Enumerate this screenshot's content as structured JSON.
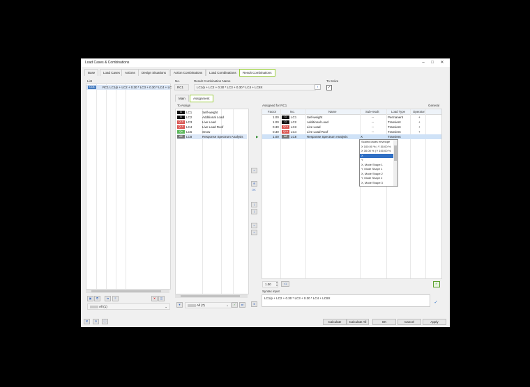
{
  "window": {
    "title": "Load Cases & Combinations"
  },
  "tabs": [
    "Base",
    "Load Cases",
    "Actions",
    "Design Situations",
    "Action Combinations",
    "Load Combinations",
    "Result Combinations"
  ],
  "list": {
    "label": "List",
    "item": {
      "badge": "CO1",
      "text": "RC1  LC1/p + LC2 + 0.30 * LC3 + 0.30 * LC4 + LC"
    },
    "filter": "All (1)"
  },
  "header": {
    "no_label": "No.",
    "no_value": "RC1",
    "name_label": "Result Combination Name",
    "name_value": "LC1/p + LC2 + 0.30 * LC3 + 0.30 * LC4 + LC8X",
    "fx": "f",
    "solve_label": "To Solve",
    "solve_check": "✓"
  },
  "subtabs": [
    "Main",
    "Assignment"
  ],
  "to_assign": {
    "label": "To Assign",
    "items": [
      {
        "badge": "G",
        "color": "#111111",
        "code": "LC1",
        "name": "Self-weight"
      },
      {
        "badge": "G",
        "color": "#111111",
        "code": "LC2",
        "name": "Additional Load"
      },
      {
        "badge": "Qi A",
        "color": "#d9534f",
        "code": "LC3",
        "name": "Live Load"
      },
      {
        "badge": "Qi A",
        "color": "#d9534f",
        "code": "LC4",
        "name": "Live Load Roof"
      },
      {
        "badge": "Qs",
        "color": "#5cb85c",
        "code": "LC6",
        "name": "Snow"
      },
      {
        "badge": "AE",
        "color": "#777777",
        "code": "LC8",
        "name": "Response Spectrum Analysis"
      }
    ],
    "filter": "All (7)"
  },
  "middle_buttons": [
    "»",
    "⊕",
    "OK",
    "|",
    "|",
    "«",
    "«"
  ],
  "assigned": {
    "label": "Assigned for RC1",
    "general": "General",
    "columns": [
      "Factor",
      "No.",
      "Name",
      "Sub-result",
      "Load Type",
      "Operator"
    ],
    "rows": [
      {
        "factor": "1.00",
        "badge": "G",
        "color": "#111111",
        "code": "LC1",
        "name": "Self-weight",
        "sub": "--",
        "type": "Permanent",
        "op": "+"
      },
      {
        "factor": "1.00",
        "badge": "G",
        "color": "#111111",
        "code": "LC2",
        "name": "Additional Load",
        "sub": "--",
        "type": "Transient",
        "op": "+"
      },
      {
        "factor": "0.30",
        "badge": "Qi A",
        "color": "#d9534f",
        "code": "LC3",
        "name": "Live Load",
        "sub": "--",
        "type": "Transient",
        "op": "+"
      },
      {
        "factor": "0.30",
        "badge": "Qi A",
        "color": "#d9534f",
        "code": "LC4",
        "name": "Live Load Roof",
        "sub": "--",
        "type": "Transient",
        "op": "+"
      },
      {
        "factor": "1.00",
        "badge": "AE",
        "color": "#777777",
        "code": "LC8",
        "name": "Response Spectrum Analysis",
        "sub": "X",
        "type": "Transient",
        "op": ""
      }
    ],
    "dropdown": [
      "Scaled cases envelope",
      "X 100.00 % | Y 30.00 %",
      "X 30.00 % | Y 100.00 %",
      "X",
      "Y",
      "X, Mode Shape 1",
      "Y, Mode Shape 1",
      "X, Mode Shape 2",
      "Y, Mode Shape 2",
      "X, Mode Shape 3"
    ],
    "factor_input": "1.00",
    "factor_unit": "×1"
  },
  "syntax": {
    "label": "Syntax input",
    "value": "LC1/p + LC2 + 0.30 * LC3 + 0.30 * LC4 + LC8X"
  },
  "buttons": {
    "calculate": "Calculate",
    "calculate_all": "Calculate All",
    "ok": "OK",
    "cancel": "Cancel",
    "apply": "Apply"
  }
}
